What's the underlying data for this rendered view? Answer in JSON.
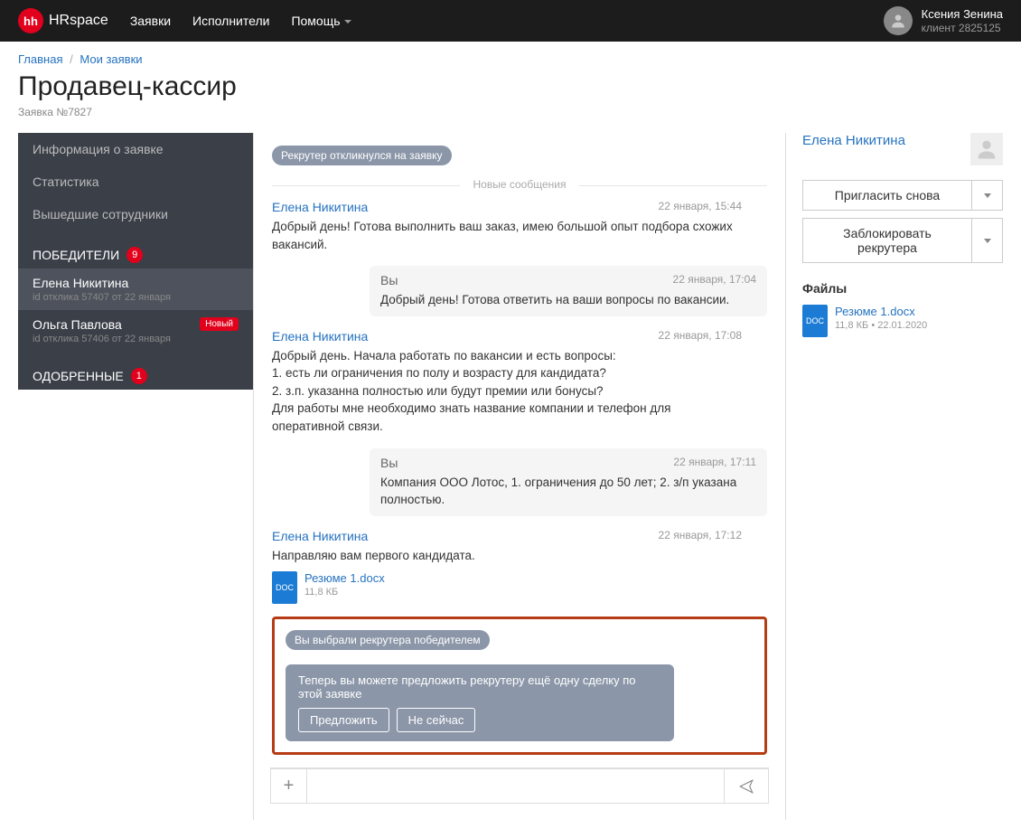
{
  "header": {
    "logo_badge": "hh",
    "logo_text": "HRspace",
    "nav": [
      "Заявки",
      "Исполнители",
      "Помощь"
    ],
    "user": {
      "name": "Ксения Зенина",
      "sub": "клиент 2825125"
    }
  },
  "breadcrumb": {
    "home": "Главная",
    "page": "Мои заявки"
  },
  "title": "Продавец-кассир",
  "request_id": "Заявка №7827",
  "sidebar": {
    "items": [
      "Информация о заявке",
      "Статистика",
      "Вышедшие сотрудники"
    ],
    "winners_label": "ПОБЕДИТЕЛИ",
    "winners_count": "9",
    "winners": [
      {
        "name": "Елена Никитина",
        "meta": "id отклика 57407 от 22 января"
      },
      {
        "name": "Ольга Павлова",
        "meta": "id отклика 57406 от 22 января",
        "badge": "Новый"
      }
    ],
    "approved_label": "ОДОБРЕННЫЕ",
    "approved_count": "1"
  },
  "chat": {
    "status_responded": "Рекрутер откликнулся на заявку",
    "new_messages": "Новые сообщения",
    "messages": [
      {
        "author": "Елена Никитина",
        "time": "22 января, 15:44",
        "text": "Добрый день! Готова выполнить ваш заказ, имею большой опыт подбора схожих вакансий.",
        "self": false
      },
      {
        "author": "Вы",
        "time": "22 января, 17:04",
        "text": "Добрый день! Готова ответить на ваши вопросы по вакансии.",
        "self": true
      },
      {
        "author": "Елена Никитина",
        "time": "22 января, 17:08",
        "text": "Добрый день. Начала работать по вакансии и есть вопросы:\n1. есть ли ограничения по полу и возрасту для кандидата?\n2. з.п. указанна полностью или будут премии или бонусы?\nДля работы мне необходимо знать название компании и телефон для оперативной связи.",
        "self": false
      },
      {
        "author": "Вы",
        "time": "22 января, 17:11",
        "text": "Компания ООО Лотос, 1. ограничения до 50 лет; 2. з/п указана полностью.",
        "self": true
      },
      {
        "author": "Елена Никитина",
        "time": "22 января, 17:12",
        "text": "Направляю вам первого кандидата.",
        "self": false,
        "attach": {
          "name": "Резюме 1.docx",
          "size": "11,8 КБ"
        }
      }
    ],
    "status_winner": "Вы выбрали рекрутера победителем",
    "offer": {
      "text": "Теперь вы можете предложить рекрутеру ещё одну сделку по этой заявке",
      "btn_offer": "Предложить",
      "btn_later": "Не сейчас"
    }
  },
  "right": {
    "recruiter": "Елена Никитина",
    "btn_invite": "Пригласить снова",
    "btn_block": "Заблокировать рекрутера",
    "files_h": "Файлы",
    "file": {
      "name": "Резюме 1.docx",
      "meta": "11,8 КБ • 22.01.2020"
    }
  }
}
